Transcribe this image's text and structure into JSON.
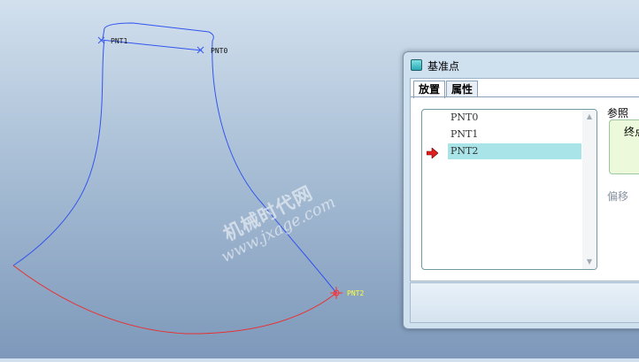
{
  "viewport": {
    "points": [
      {
        "name": "PNT0"
      },
      {
        "name": "PNT1"
      },
      {
        "name": "PNT2"
      }
    ],
    "colors": {
      "sketch": "#3355ee",
      "arc": "#e83030",
      "point_label": "#111111",
      "active_point": "#ffff33",
      "active_marker": "#ff3030"
    }
  },
  "watermark": {
    "cn": "机械时代网",
    "url": "www.jxage.com"
  },
  "dialog": {
    "title": "基准点",
    "tabs": [
      {
        "label": "放置"
      },
      {
        "label": "属性"
      }
    ],
    "points_list": [
      "PNT0",
      "PNT1",
      "PNT2"
    ],
    "selected_index": 2,
    "reference_label": "参照",
    "reference_value": "终点",
    "offset_label": "偏移"
  }
}
